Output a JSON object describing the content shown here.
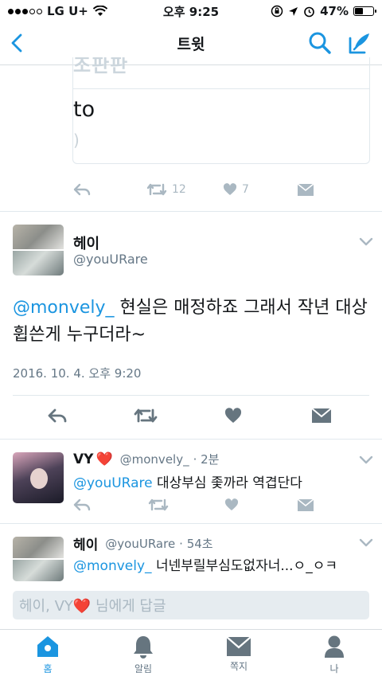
{
  "status_bar": {
    "carrier": "LG U+",
    "time": "오후 9:25",
    "battery": "47%",
    "battery_level": 0.47
  },
  "nav": {
    "title": "트윗",
    "back_icon": "chevron-left-icon",
    "search_icon": "search-icon",
    "compose_icon": "compose-icon"
  },
  "quoted_card": {
    "top_partial": "조판판",
    "title": "to",
    "stats": {
      "retweets": "12",
      "likes": "7"
    }
  },
  "main_tweet": {
    "name": "헤이",
    "handle": "@youURare",
    "mention": "@monvely_",
    "text": " 현실은 매정하죠 그래서 작년 대상휩쓴게 누구더라~",
    "date": "2016. 10. 4. 오후 9:20"
  },
  "replies": [
    {
      "name": "VY",
      "heart": "❤️",
      "handle": "@monvely_",
      "time": "· 2분",
      "mention": "@youURare",
      "text": " 대상부심 좇까라 역겹단다"
    },
    {
      "name": "헤이",
      "handle": "@youURare",
      "time": "· 54초",
      "mention": "@monvely_",
      "text": " 너넨부릴부심도없자너...ㅇ_ㅇㅋ"
    }
  ],
  "reply_input": {
    "placeholder": "헤이, VY❤️ 님에게 답글"
  },
  "tabs": [
    {
      "label": "홈",
      "icon": "home-icon",
      "active": true
    },
    {
      "label": "알림",
      "icon": "bell-icon",
      "active": false
    },
    {
      "label": "쪽지",
      "icon": "envelope-icon",
      "active": false
    },
    {
      "label": "나",
      "icon": "person-icon",
      "active": false
    }
  ],
  "colors": {
    "accent": "#1b95e0",
    "muted": "#657786",
    "icon_gray": "#aab8c2",
    "dark_icon": "#66757f"
  }
}
